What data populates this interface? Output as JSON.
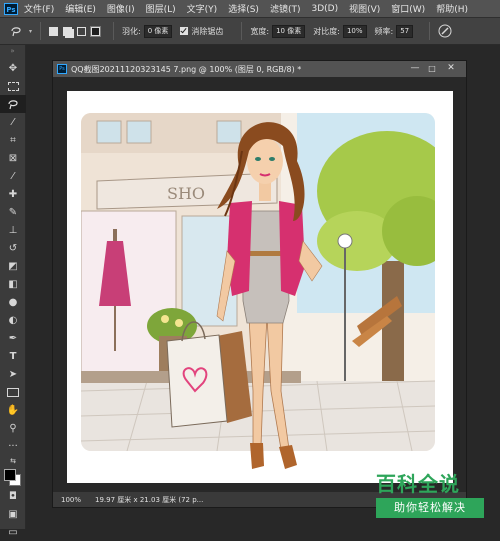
{
  "app": {
    "logo": "Ps",
    "menu": [
      "文件(F)",
      "编辑(E)",
      "图像(I)",
      "图层(L)",
      "文字(Y)",
      "选择(S)",
      "滤镜(T)",
      "3D(D)",
      "视图(V)",
      "窗口(W)",
      "帮助(H)"
    ]
  },
  "options": {
    "feather_label": "羽化:",
    "feather_value": "0 像素",
    "antialias_label": "消除锯齿",
    "width_label": "宽度:",
    "width_value": "10 像素",
    "contrast_label": "对比度:",
    "contrast_value": "10%",
    "frequency_label": "频率:",
    "frequency_value": "57"
  },
  "toolbar": {
    "tools": [
      "move",
      "marquee",
      "lasso",
      "magic-wand",
      "crop",
      "frame",
      "eyedropper",
      "spot-heal",
      "brush",
      "stamp",
      "history-brush",
      "eraser",
      "gradient",
      "blur",
      "dodge",
      "pen",
      "text",
      "path-select",
      "shape",
      "hand",
      "zoom",
      "more",
      "swap",
      "colors",
      "quickmask",
      "screenmode",
      "artboard"
    ]
  },
  "document": {
    "title": "QQ截图20211120323145 7.png @ 100% (图层 0, RGB/8) *",
    "zoom": "100%",
    "status": "19.97 厘米 x 21.03 厘米 (72 p..."
  },
  "watermark": {
    "title": "百科全说",
    "subtitle": "助你轻松解决"
  },
  "colors": {
    "pink": "#d6306f",
    "psblue": "#31a8ff",
    "green": "#2ea55a"
  }
}
